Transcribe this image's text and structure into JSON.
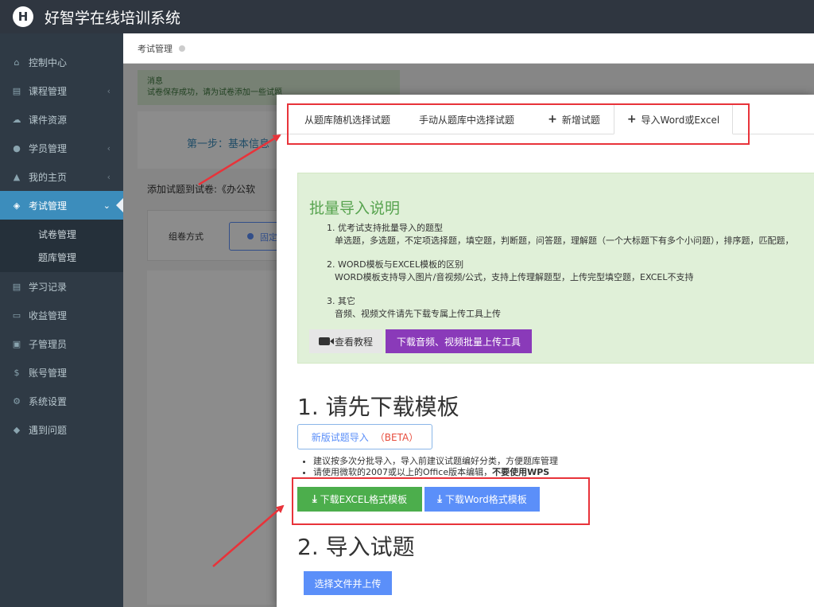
{
  "app": {
    "logo_letter": "H",
    "title": "好智学在线培训系统"
  },
  "sidebar": {
    "items": [
      {
        "label": "控制中心",
        "icon": "home-icon",
        "glyph": "⌂",
        "chevron": ""
      },
      {
        "label": "课程管理",
        "icon": "book-icon",
        "glyph": "▤",
        "chevron": "‹"
      },
      {
        "label": "课件资源",
        "icon": "cloud-icon",
        "glyph": "☁",
        "chevron": ""
      },
      {
        "label": "学员管理",
        "icon": "users-icon",
        "glyph": "●",
        "chevron": "‹"
      },
      {
        "label": "我的主页",
        "icon": "graduation-cap-icon",
        "glyph": "▲",
        "chevron": "‹"
      },
      {
        "label": "考试管理",
        "icon": "tags-icon",
        "glyph": "◈",
        "chevron": "⌄"
      },
      {
        "label": "学习记录",
        "icon": "book-open-icon",
        "glyph": "▤",
        "chevron": ""
      },
      {
        "label": "收益管理",
        "icon": "credit-card-icon",
        "glyph": "▭",
        "chevron": ""
      },
      {
        "label": "子管理员",
        "icon": "lock-icon",
        "glyph": "▣",
        "chevron": ""
      },
      {
        "label": "账号管理",
        "icon": "dollar-icon",
        "glyph": "$",
        "chevron": ""
      },
      {
        "label": "系统设置",
        "icon": "gear-icon",
        "glyph": "⚙",
        "chevron": ""
      },
      {
        "label": "遇到问题",
        "icon": "tag-icon",
        "glyph": "◆",
        "chevron": ""
      }
    ],
    "sub_items": [
      "试卷管理",
      "题库管理"
    ]
  },
  "breadcrumb": {
    "label": "考试管理"
  },
  "underlying": {
    "message_title": "消息",
    "message_text": "试卷保存成功，请为试卷添加一些试题",
    "step_text": "第一步：基本信息",
    "add_title": "添加试题到试卷:《办公软",
    "compose_label": "组卷方式",
    "compose_option": "固定"
  },
  "modal": {
    "tabs": [
      {
        "label": "从题库随机选择试题",
        "plus": false
      },
      {
        "label": "手动从题库中选择试题",
        "plus": false
      },
      {
        "label": "新增试题",
        "plus": true
      },
      {
        "label": "导入Word或Excel",
        "plus": true
      }
    ],
    "info": {
      "title": "批量导入说明",
      "line1": "1. 优考试支持批量导入的题型",
      "line1b": "单选题，多选题，不定项选择题，填空题，判断题，问答题，理解题（一个大标题下有多个小问题），排序题，匹配题，",
      "line2": "2. WORD模板与EXCEL模板的区别",
      "line2b": "WORD模板支持导入图片/音视频/公式，支持上传理解题型，上传完型填空题，EXCEL不支持",
      "line3": "3. 其它",
      "line3b": "音频、视频文件请先下载专属上传工具上传",
      "tutorial_btn": "查看教程",
      "download_tool_btn": "下载音频、视频批量上传工具"
    },
    "step1_title": "1. 请先下载模板",
    "beta_btn": "新版试题导入",
    "beta_tag": "（BETA）",
    "bullet1": "建议按多次分批导入，导入前建议试题编好分类，方便题库管理",
    "bullet2a": "请使用微软的2007或以上的Office版本编辑，",
    "bullet2b": "不要使用WPS",
    "excel_btn": "下载EXCEL格式模板",
    "word_btn": "下载Word格式模板",
    "step2_title": "2. 导入试题",
    "upload_btn": "选择文件并上传"
  },
  "colors": {
    "topbar": "#2f3640",
    "sidebar": "#2f3a45",
    "active": "#3c8dbc",
    "annotation": "#e8333a",
    "excel_green": "#4cae4c",
    "word_blue": "#5b8ff9",
    "purple": "#8a3ab9"
  }
}
